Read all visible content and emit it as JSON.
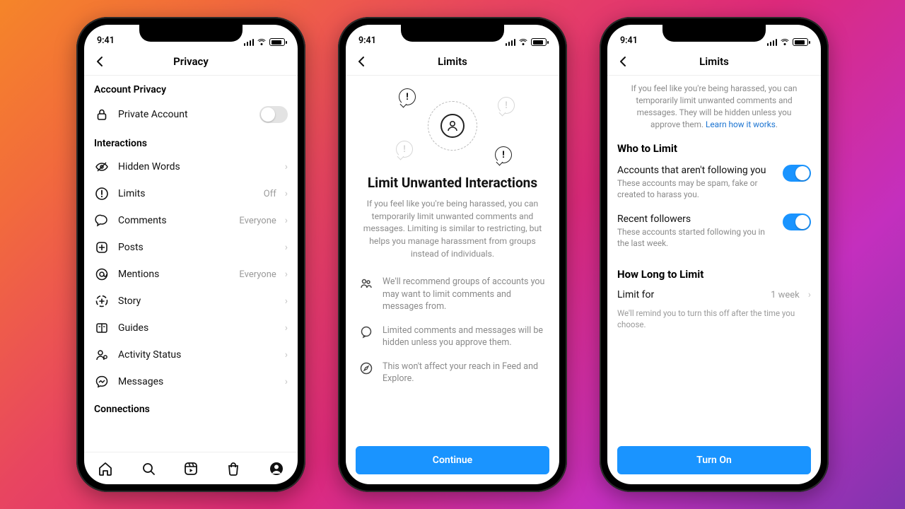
{
  "status": {
    "time": "9:41"
  },
  "phone1": {
    "title": "Privacy",
    "section_privacy": "Account Privacy",
    "private_account": "Private Account",
    "section_interactions": "Interactions",
    "rows": {
      "hiddenWords": "Hidden Words",
      "limits": "Limits",
      "limitsValue": "Off",
      "comments": "Comments",
      "commentsValue": "Everyone",
      "posts": "Posts",
      "mentions": "Mentions",
      "mentionsValue": "Everyone",
      "story": "Story",
      "guides": "Guides",
      "activity": "Activity Status",
      "messages": "Messages"
    },
    "section_connections": "Connections"
  },
  "phone2": {
    "title": "Limits",
    "headline": "Limit Unwanted Interactions",
    "body": "If you feel like you're being harassed, you can temporarily limit unwanted comments and messages. Limiting is similar to restricting, but helps you manage harassment from groups instead of individuals.",
    "bullets": [
      "We'll recommend groups of accounts you may want to limit comments and messages from.",
      "Limited comments and messages will be hidden unless you approve them.",
      "This won't affect your reach in Feed and Explore."
    ],
    "button": "Continue"
  },
  "phone3": {
    "title": "Limits",
    "top_text": "If you feel like you're being harassed, you can temporarily limit unwanted comments and messages. They will be hidden unless you approve them. ",
    "learn_link": "Learn how it works",
    "section_who": "Who to Limit",
    "opt1_title": "Accounts that aren't following you",
    "opt1_sub": "These accounts may be spam, fake or created to harass you.",
    "opt2_title": "Recent followers",
    "opt2_sub": "These accounts started following you in the last week.",
    "section_howlong": "How Long to Limit",
    "limit_for": "Limit for",
    "limit_value": "1 week",
    "note": "We'll remind you to turn this off after the time you choose.",
    "button": "Turn On"
  }
}
